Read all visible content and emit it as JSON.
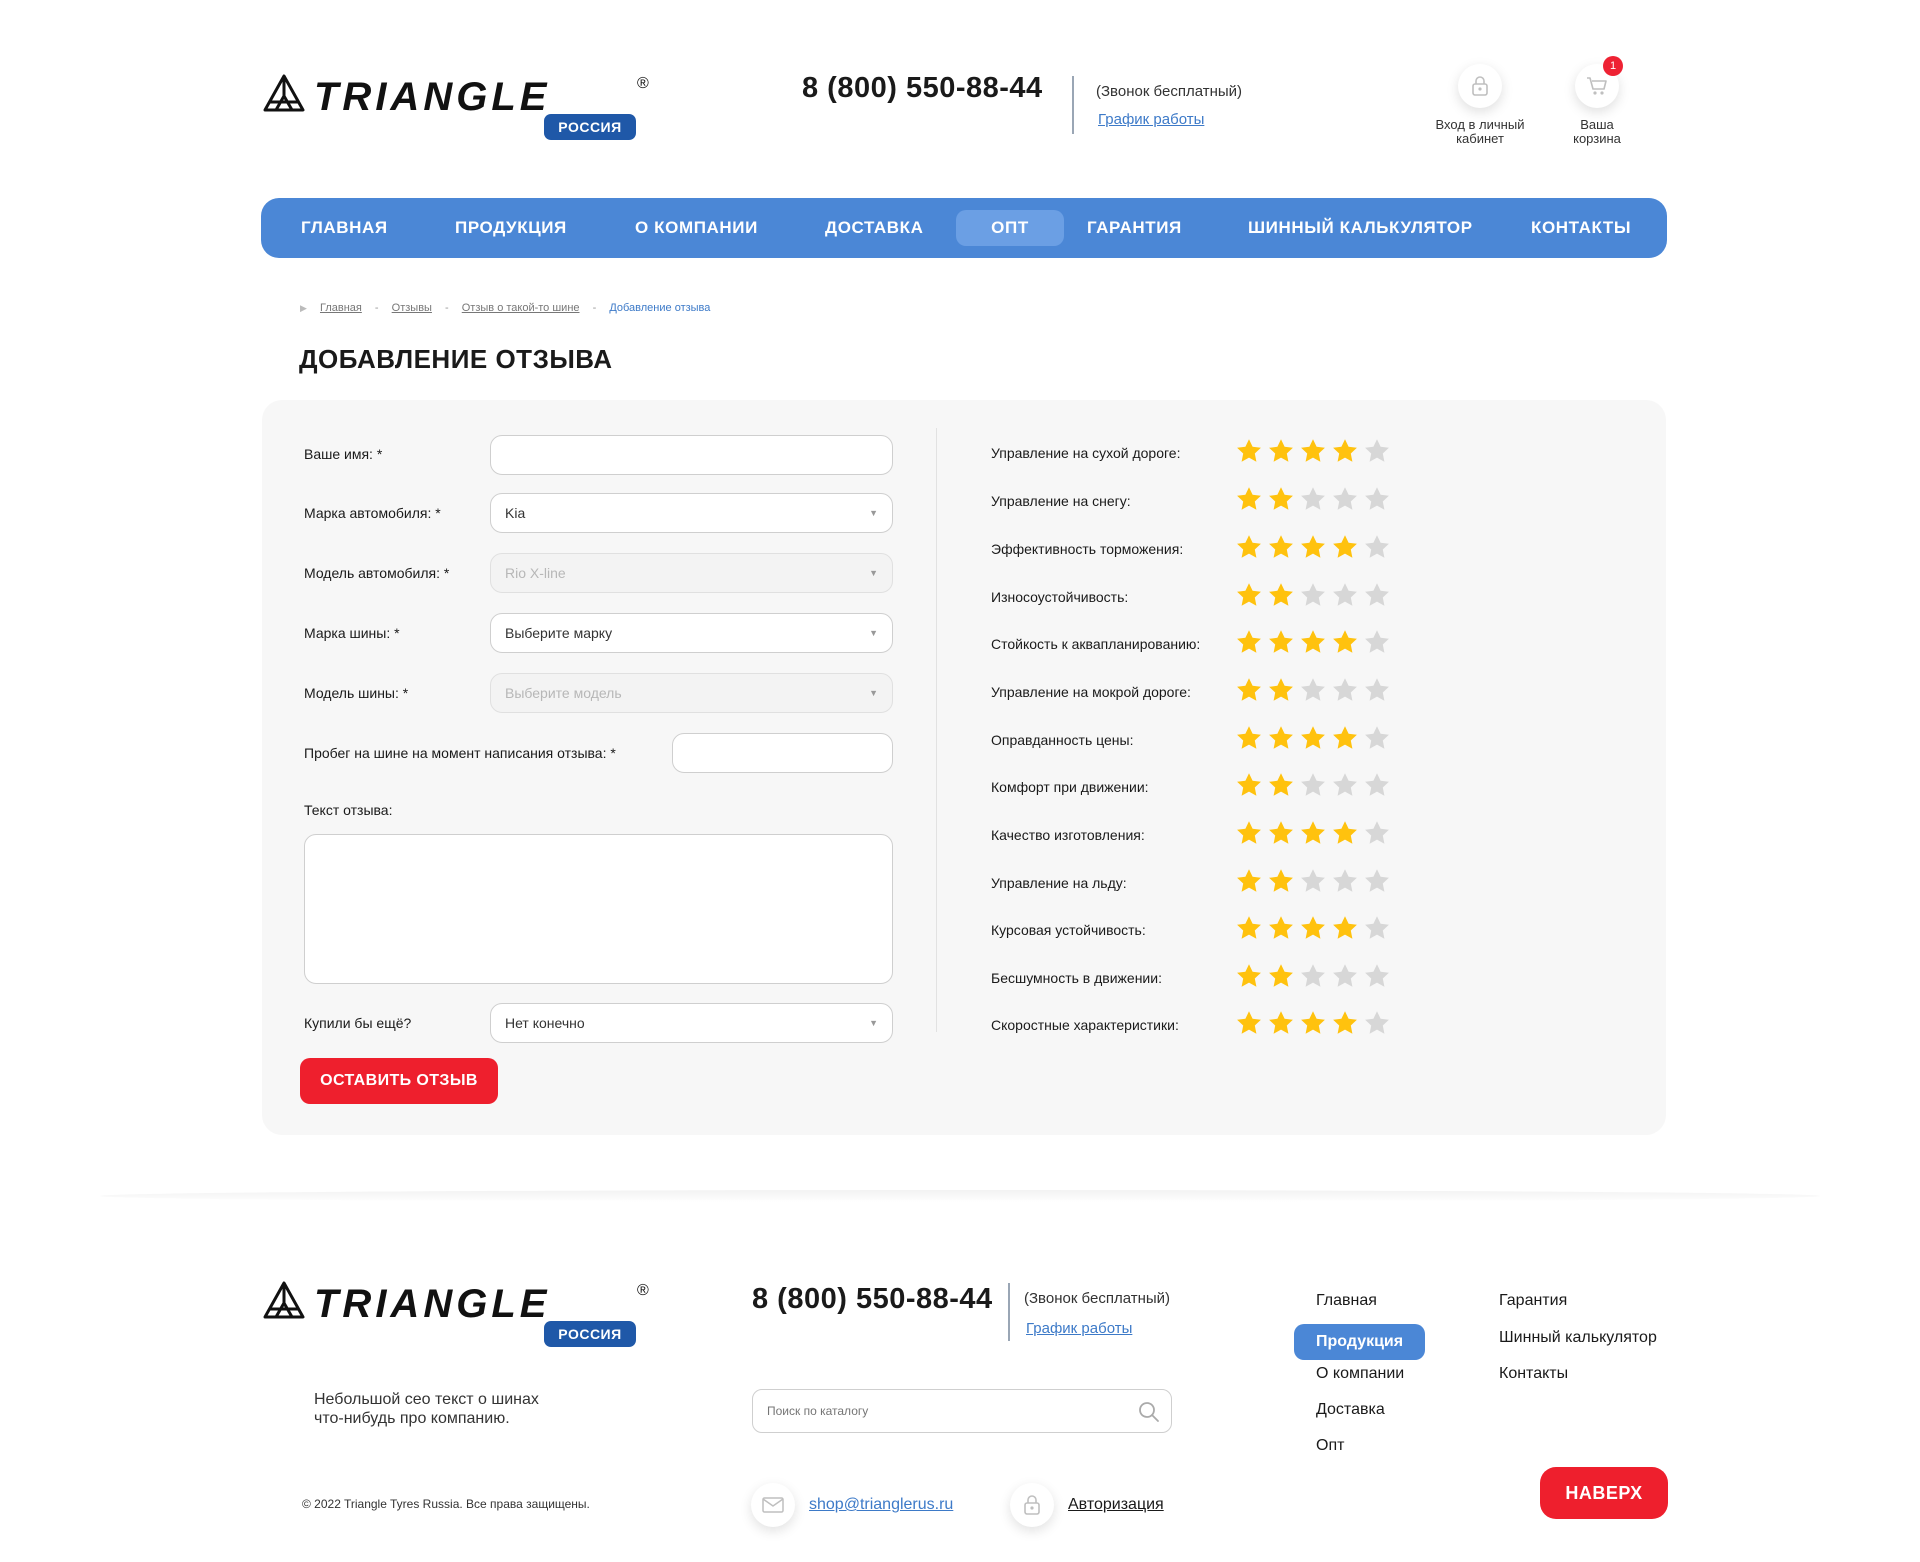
{
  "brand": {
    "name": "TRIANGLE",
    "badge": "РОССИЯ",
    "registered": "®"
  },
  "header": {
    "phone": "8 (800) 550-88-44",
    "call_note": "(Звонок бесплатный)",
    "schedule_link": "График работы",
    "login_label_1": "Вход в личный",
    "login_label_2": "кабинет",
    "cart_label_1": "Ваша",
    "cart_label_2": "корзина",
    "cart_count": "1"
  },
  "nav": {
    "items": [
      {
        "label": "ГЛАВНАЯ"
      },
      {
        "label": "ПРОДУКЦИЯ"
      },
      {
        "label": "О КОМПАНИИ"
      },
      {
        "label": "ДОСТАВКА"
      },
      {
        "label": "ОПТ"
      },
      {
        "label": "ГАРАНТИЯ"
      },
      {
        "label": "ШИННЫЙ КАЛЬКУЛЯТОР"
      },
      {
        "label": "КОНТАКТЫ"
      }
    ],
    "active": "ОПТ"
  },
  "breadcrumbs": {
    "items": [
      "Главная",
      "Отзывы",
      "Отзыв о такой-то шине",
      "Добавление отзыва"
    ]
  },
  "page": {
    "title": "ДОБАВЛЕНИЕ ОТЗЫВА"
  },
  "form": {
    "name_label": "Ваше имя: *",
    "name_value": "",
    "car_brand_label": "Марка автомобиля: *",
    "car_brand_value": "Kia",
    "car_model_label": "Модель автомобиля: *",
    "car_model_value": "Rio X-line",
    "tire_brand_label": "Марка шины: *",
    "tire_brand_value": "Выберите марку",
    "tire_model_label": "Модель шины: *",
    "tire_model_value": "Выберите модель",
    "mileage_label": "Пробег на шине на момент написания отзыва: *",
    "mileage_value": "",
    "text_label": "Текст отзыва:",
    "text_value": "",
    "buy_again_label": "Купили бы ещё?",
    "buy_again_value": "Нет конечно",
    "submit_label": "ОСТАВИТЬ ОТЗЫВ"
  },
  "ratings": {
    "max": 5,
    "items": [
      {
        "label": "Управление на сухой дороге:",
        "value": 4
      },
      {
        "label": "Управление на снегу:",
        "value": 2
      },
      {
        "label": "Эффективность торможения:",
        "value": 4
      },
      {
        "label": "Износоустойчивость:",
        "value": 2
      },
      {
        "label": "Стойкость к аквапланированию:",
        "value": 4
      },
      {
        "label": "Управление на мокрой дороге:",
        "value": 2
      },
      {
        "label": "Оправданность цены:",
        "value": 4
      },
      {
        "label": "Комфорт при движении:",
        "value": 2
      },
      {
        "label": "Качество изготовления:",
        "value": 4
      },
      {
        "label": "Управление на льду:",
        "value": 2
      },
      {
        "label": "Курсовая устойчивость:",
        "value": 4
      },
      {
        "label": "Бесшумность в движении:",
        "value": 2
      },
      {
        "label": "Скоростные характеристики:",
        "value": 4
      }
    ]
  },
  "footer": {
    "phone": "8 (800) 550-88-44",
    "call_note": "(Звонок бесплатный)",
    "schedule_link": "График работы",
    "seo_text_1": "Небольшой сео текст о шинах",
    "seo_text_2": "что-нибудь про компанию.",
    "search_placeholder": "Поиск по каталогу",
    "email": "shop@trianglerus.ru",
    "auth_link": "Авторизация",
    "copyright": "© 2022 Triangle Tyres Russia. Все права защищены.",
    "nav_col1": [
      "Главная",
      "Продукция",
      "О компании",
      "Доставка",
      "Опт"
    ],
    "nav_col2": [
      "Гарантия",
      "Шинный калькулятор",
      "Контакты"
    ],
    "nav_active": "Продукция",
    "top_button": "НАВЕРХ"
  },
  "colors": {
    "accent": "#4b87d6",
    "button_red": "#ee1f2d",
    "star_on": "#ffc20e",
    "star_off": "#d7d7d7",
    "badge_blue": "#1f58a8"
  }
}
